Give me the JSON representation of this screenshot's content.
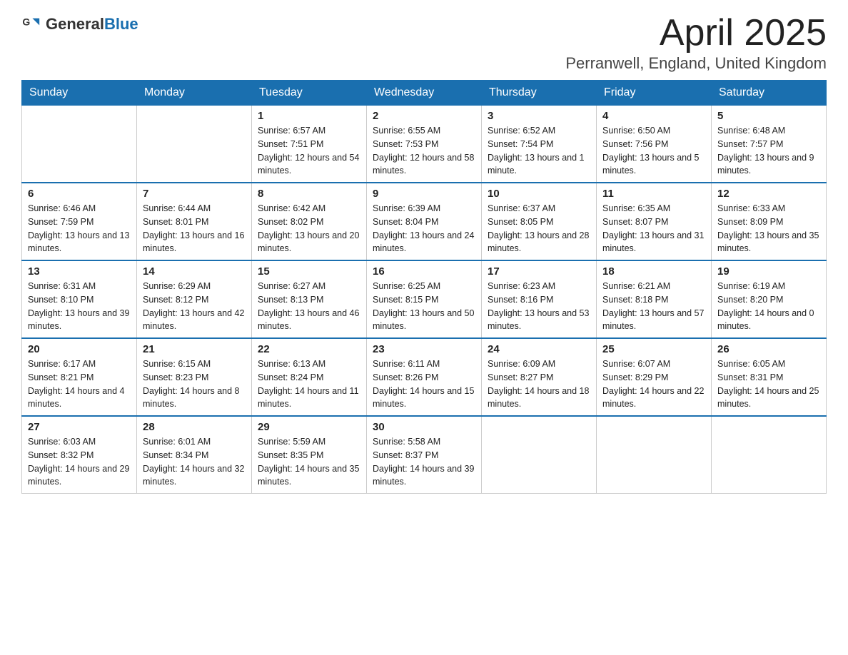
{
  "header": {
    "logo_general": "General",
    "logo_blue": "Blue",
    "month_title": "April 2025",
    "location": "Perranwell, England, United Kingdom"
  },
  "weekdays": [
    "Sunday",
    "Monday",
    "Tuesday",
    "Wednesday",
    "Thursday",
    "Friday",
    "Saturday"
  ],
  "weeks": [
    [
      {
        "day": "",
        "sunrise": "",
        "sunset": "",
        "daylight": ""
      },
      {
        "day": "",
        "sunrise": "",
        "sunset": "",
        "daylight": ""
      },
      {
        "day": "1",
        "sunrise": "Sunrise: 6:57 AM",
        "sunset": "Sunset: 7:51 PM",
        "daylight": "Daylight: 12 hours and 54 minutes."
      },
      {
        "day": "2",
        "sunrise": "Sunrise: 6:55 AM",
        "sunset": "Sunset: 7:53 PM",
        "daylight": "Daylight: 12 hours and 58 minutes."
      },
      {
        "day": "3",
        "sunrise": "Sunrise: 6:52 AM",
        "sunset": "Sunset: 7:54 PM",
        "daylight": "Daylight: 13 hours and 1 minute."
      },
      {
        "day": "4",
        "sunrise": "Sunrise: 6:50 AM",
        "sunset": "Sunset: 7:56 PM",
        "daylight": "Daylight: 13 hours and 5 minutes."
      },
      {
        "day": "5",
        "sunrise": "Sunrise: 6:48 AM",
        "sunset": "Sunset: 7:57 PM",
        "daylight": "Daylight: 13 hours and 9 minutes."
      }
    ],
    [
      {
        "day": "6",
        "sunrise": "Sunrise: 6:46 AM",
        "sunset": "Sunset: 7:59 PM",
        "daylight": "Daylight: 13 hours and 13 minutes."
      },
      {
        "day": "7",
        "sunrise": "Sunrise: 6:44 AM",
        "sunset": "Sunset: 8:01 PM",
        "daylight": "Daylight: 13 hours and 16 minutes."
      },
      {
        "day": "8",
        "sunrise": "Sunrise: 6:42 AM",
        "sunset": "Sunset: 8:02 PM",
        "daylight": "Daylight: 13 hours and 20 minutes."
      },
      {
        "day": "9",
        "sunrise": "Sunrise: 6:39 AM",
        "sunset": "Sunset: 8:04 PM",
        "daylight": "Daylight: 13 hours and 24 minutes."
      },
      {
        "day": "10",
        "sunrise": "Sunrise: 6:37 AM",
        "sunset": "Sunset: 8:05 PM",
        "daylight": "Daylight: 13 hours and 28 minutes."
      },
      {
        "day": "11",
        "sunrise": "Sunrise: 6:35 AM",
        "sunset": "Sunset: 8:07 PM",
        "daylight": "Daylight: 13 hours and 31 minutes."
      },
      {
        "day": "12",
        "sunrise": "Sunrise: 6:33 AM",
        "sunset": "Sunset: 8:09 PM",
        "daylight": "Daylight: 13 hours and 35 minutes."
      }
    ],
    [
      {
        "day": "13",
        "sunrise": "Sunrise: 6:31 AM",
        "sunset": "Sunset: 8:10 PM",
        "daylight": "Daylight: 13 hours and 39 minutes."
      },
      {
        "day": "14",
        "sunrise": "Sunrise: 6:29 AM",
        "sunset": "Sunset: 8:12 PM",
        "daylight": "Daylight: 13 hours and 42 minutes."
      },
      {
        "day": "15",
        "sunrise": "Sunrise: 6:27 AM",
        "sunset": "Sunset: 8:13 PM",
        "daylight": "Daylight: 13 hours and 46 minutes."
      },
      {
        "day": "16",
        "sunrise": "Sunrise: 6:25 AM",
        "sunset": "Sunset: 8:15 PM",
        "daylight": "Daylight: 13 hours and 50 minutes."
      },
      {
        "day": "17",
        "sunrise": "Sunrise: 6:23 AM",
        "sunset": "Sunset: 8:16 PM",
        "daylight": "Daylight: 13 hours and 53 minutes."
      },
      {
        "day": "18",
        "sunrise": "Sunrise: 6:21 AM",
        "sunset": "Sunset: 8:18 PM",
        "daylight": "Daylight: 13 hours and 57 minutes."
      },
      {
        "day": "19",
        "sunrise": "Sunrise: 6:19 AM",
        "sunset": "Sunset: 8:20 PM",
        "daylight": "Daylight: 14 hours and 0 minutes."
      }
    ],
    [
      {
        "day": "20",
        "sunrise": "Sunrise: 6:17 AM",
        "sunset": "Sunset: 8:21 PM",
        "daylight": "Daylight: 14 hours and 4 minutes."
      },
      {
        "day": "21",
        "sunrise": "Sunrise: 6:15 AM",
        "sunset": "Sunset: 8:23 PM",
        "daylight": "Daylight: 14 hours and 8 minutes."
      },
      {
        "day": "22",
        "sunrise": "Sunrise: 6:13 AM",
        "sunset": "Sunset: 8:24 PM",
        "daylight": "Daylight: 14 hours and 11 minutes."
      },
      {
        "day": "23",
        "sunrise": "Sunrise: 6:11 AM",
        "sunset": "Sunset: 8:26 PM",
        "daylight": "Daylight: 14 hours and 15 minutes."
      },
      {
        "day": "24",
        "sunrise": "Sunrise: 6:09 AM",
        "sunset": "Sunset: 8:27 PM",
        "daylight": "Daylight: 14 hours and 18 minutes."
      },
      {
        "day": "25",
        "sunrise": "Sunrise: 6:07 AM",
        "sunset": "Sunset: 8:29 PM",
        "daylight": "Daylight: 14 hours and 22 minutes."
      },
      {
        "day": "26",
        "sunrise": "Sunrise: 6:05 AM",
        "sunset": "Sunset: 8:31 PM",
        "daylight": "Daylight: 14 hours and 25 minutes."
      }
    ],
    [
      {
        "day": "27",
        "sunrise": "Sunrise: 6:03 AM",
        "sunset": "Sunset: 8:32 PM",
        "daylight": "Daylight: 14 hours and 29 minutes."
      },
      {
        "day": "28",
        "sunrise": "Sunrise: 6:01 AM",
        "sunset": "Sunset: 8:34 PM",
        "daylight": "Daylight: 14 hours and 32 minutes."
      },
      {
        "day": "29",
        "sunrise": "Sunrise: 5:59 AM",
        "sunset": "Sunset: 8:35 PM",
        "daylight": "Daylight: 14 hours and 35 minutes."
      },
      {
        "day": "30",
        "sunrise": "Sunrise: 5:58 AM",
        "sunset": "Sunset: 8:37 PM",
        "daylight": "Daylight: 14 hours and 39 minutes."
      },
      {
        "day": "",
        "sunrise": "",
        "sunset": "",
        "daylight": ""
      },
      {
        "day": "",
        "sunrise": "",
        "sunset": "",
        "daylight": ""
      },
      {
        "day": "",
        "sunrise": "",
        "sunset": "",
        "daylight": ""
      }
    ]
  ]
}
